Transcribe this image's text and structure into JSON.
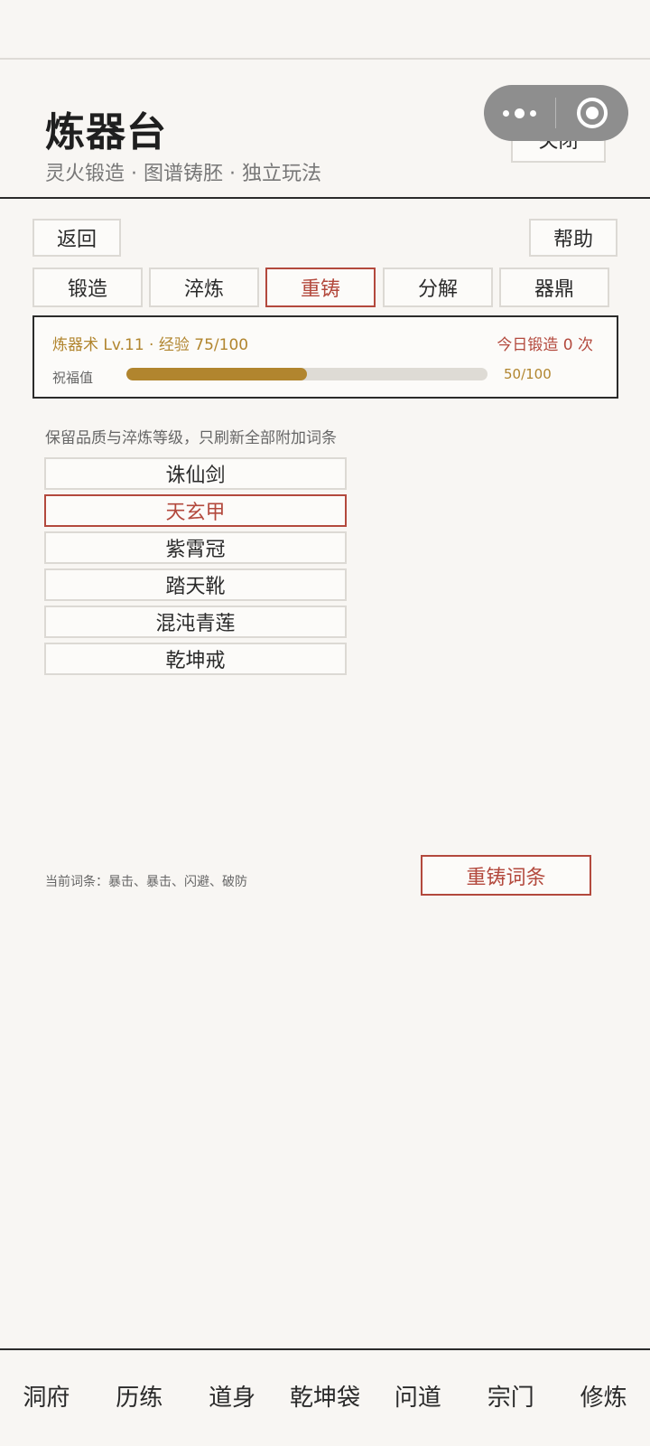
{
  "header": {
    "title": "炼器台",
    "subtitle": "灵火锻造 · 图谱铸胚 · 独立玩法",
    "close_label": "关闭"
  },
  "nav": {
    "back_label": "返回",
    "help_label": "帮助"
  },
  "tabs": [
    {
      "label": "锻造",
      "active": false
    },
    {
      "label": "淬炼",
      "active": false
    },
    {
      "label": "重铸",
      "active": true
    },
    {
      "label": "分解",
      "active": false
    },
    {
      "label": "器鼎",
      "active": false
    }
  ],
  "status": {
    "level_text": "炼器术 Lv.11 · 经验 75/100",
    "today_text": "今日锻造 0 次",
    "bless_label": "祝福值",
    "bless_value": 50,
    "bless_max": 100,
    "bless_text": "50/100"
  },
  "recast": {
    "description": "保留品质与淬炼等级，只刷新全部附加词条",
    "items": [
      {
        "label": "诛仙剑",
        "selected": false
      },
      {
        "label": "天玄甲",
        "selected": true
      },
      {
        "label": "紫霄冠",
        "selected": false
      },
      {
        "label": "踏天靴",
        "selected": false
      },
      {
        "label": "混沌青莲",
        "selected": false
      },
      {
        "label": "乾坤戒",
        "selected": false
      }
    ],
    "current_affixes": "当前词条：暴击、暴击、闪避、破防",
    "action_label": "重铸词条"
  },
  "bottom_nav": [
    "洞府",
    "历练",
    "道身",
    "乾坤袋",
    "问道",
    "宗门",
    "修炼"
  ],
  "colors": {
    "accent_red": "#b3493d",
    "accent_gold": "#b1852e",
    "background": "#f8f6f3"
  }
}
